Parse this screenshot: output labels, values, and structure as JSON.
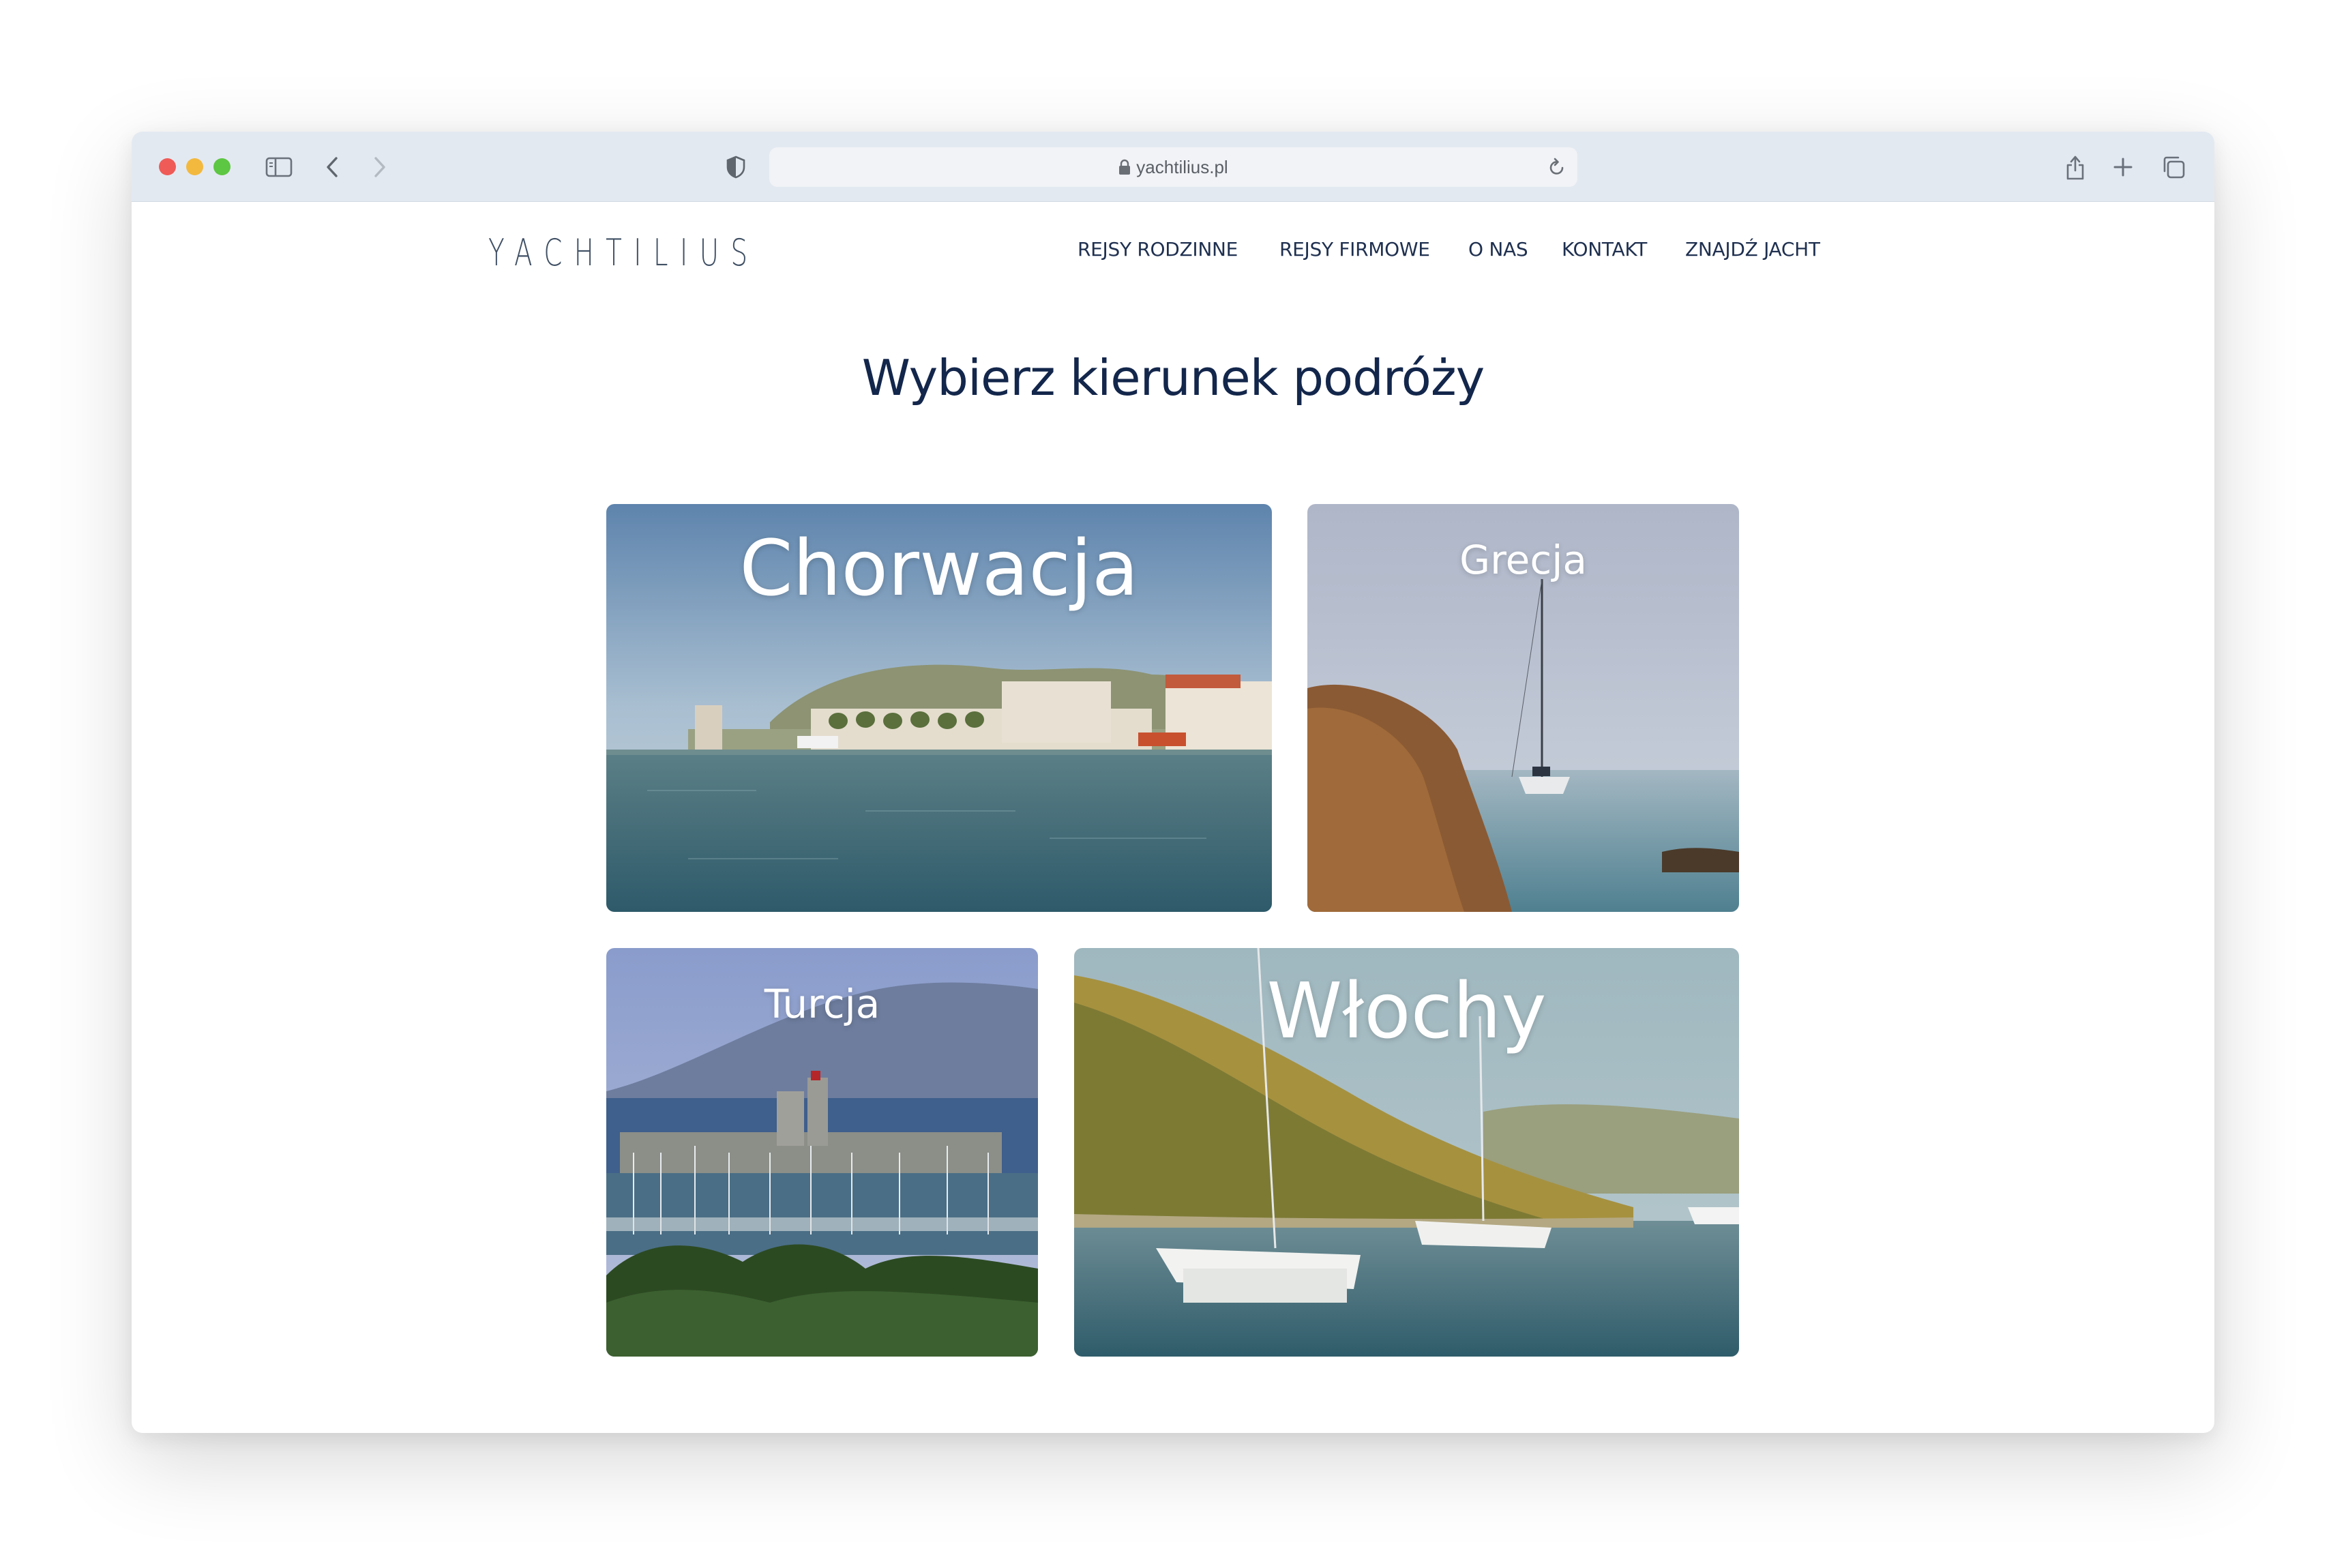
{
  "browser": {
    "url": "yachtilius.pl",
    "toolbar_icons": [
      "sidebar-icon",
      "back-icon",
      "forward-icon",
      "shield-icon",
      "lock-icon",
      "reload-icon",
      "share-icon",
      "new-tab-icon",
      "tabs-overview-icon"
    ]
  },
  "site": {
    "logo": "YACHTILIUS",
    "nav": [
      {
        "label": "REJSY RODZINNE"
      },
      {
        "label": "REJSY FIRMOWE"
      },
      {
        "label": "O NAS"
      },
      {
        "label": "KONTAKT"
      },
      {
        "label": "ZNAJDŹ JACHT"
      }
    ],
    "headline": "Wybierz kierunek podróży",
    "destinations": [
      {
        "name": "Chorwacja"
      },
      {
        "name": "Grecja"
      },
      {
        "name": "Turcja"
      },
      {
        "name": "Włochy"
      }
    ]
  },
  "colors": {
    "toolbar": "#e3e9f1",
    "text_navy": "#13264b",
    "nav_text": "#1f3050",
    "logo": "#3f4f64"
  }
}
